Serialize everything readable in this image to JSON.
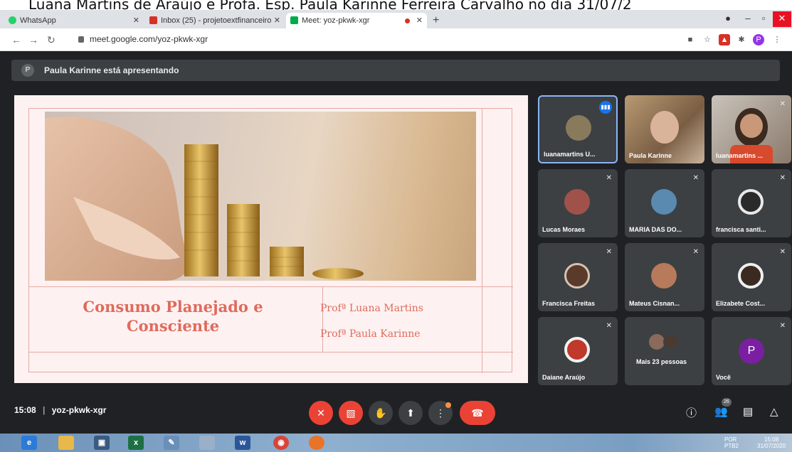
{
  "caption": "Luana Martins de Araújo e Profa. Esp. Paula Karinne Ferreira Carvalho no dia 31/07/2",
  "browser": {
    "tabs": [
      {
        "label": "WhatsApp",
        "favicon": "whatsapp-icon",
        "color": "#25d366"
      },
      {
        "label": "Inbox (25) - projetoextfinanceiro",
        "favicon": "gmail-icon",
        "color": "#d93025"
      },
      {
        "label": "Meet: yoz-pkwk-xgr",
        "favicon": "meet-icon",
        "color": "#00ac47"
      }
    ],
    "url": "meet.google.com/yoz-pkwk-xgr",
    "profile_initial": "P"
  },
  "meet": {
    "presenting_banner": "Paula Karinne está apresentando",
    "presenter_initial": "P",
    "slide": {
      "title": "Consumo Planejado e Consciente",
      "prof1": "Profª Luana Martins",
      "prof2": "Profª Paula Karinne"
    },
    "participants": [
      {
        "name": "luanamartins U...",
        "type": "video-active"
      },
      {
        "name": "Paula Karinne",
        "type": "video"
      },
      {
        "name": "luanamartins ...",
        "type": "video"
      },
      {
        "name": "Lucas Moraes",
        "type": "avatar"
      },
      {
        "name": "MARIA DAS DO...",
        "type": "avatar"
      },
      {
        "name": "francisca santi...",
        "type": "avatar"
      },
      {
        "name": "Francisca Freitas",
        "type": "avatar"
      },
      {
        "name": "Mateus Cisnan...",
        "type": "avatar"
      },
      {
        "name": "Elizabete Cost...",
        "type": "avatar"
      },
      {
        "name": "Daiane Araújo",
        "type": "avatar"
      },
      {
        "name": "Mais 23 pessoas",
        "type": "group"
      },
      {
        "name": "Você",
        "type": "initial",
        "initial": "P"
      }
    ],
    "time": "15:08",
    "separator": "|",
    "meeting_code": "yoz-pkwk-xgr",
    "participant_count": "26"
  },
  "taskbar": {
    "lang": "POR",
    "lang_sub": "PTB2",
    "clock": "15:08",
    "date": "31/07/2020"
  },
  "colors": {
    "accent_red": "#ea4335",
    "slide_text": "#e06a5c",
    "meet_bg": "#202124"
  }
}
